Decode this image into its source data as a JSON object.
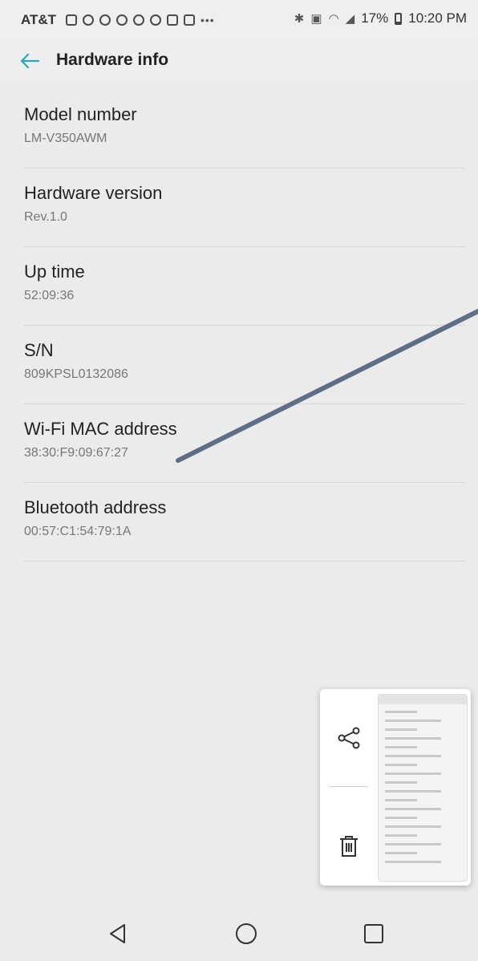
{
  "status_bar": {
    "carrier": "AT&T",
    "battery": "17%",
    "time": "10:20 PM",
    "icons": [
      "message-icon",
      "whatsapp-icon",
      "notification-icon",
      "notification-icon",
      "voicemail-icon",
      "chrome-icon",
      "gallery-icon",
      "app-icon",
      "more-icon",
      "bluetooth-icon",
      "nfc-icon",
      "wifi-icon",
      "signal-icon",
      "battery-icon"
    ]
  },
  "app_bar": {
    "title": "Hardware info"
  },
  "items": [
    {
      "label": "Model number",
      "value": "LM-V350AWM"
    },
    {
      "label": "Hardware version",
      "value": "Rev.1.0"
    },
    {
      "label": "Up time",
      "value": "52:09:36"
    },
    {
      "label": "S/N",
      "value": "809KPSL0132086"
    },
    {
      "label": "Wi-Fi MAC address",
      "value": "38:30:F9:09:67:27"
    },
    {
      "label": "Bluetooth address",
      "value": "00:57:C1:54:79:1A"
    }
  ],
  "screenshot_preview": {
    "actions": [
      "share-icon",
      "delete-icon"
    ]
  },
  "nav_bar": {
    "buttons": [
      "back-icon",
      "home-icon",
      "recents-icon"
    ]
  },
  "colors": {
    "accent": "#26a7c1",
    "annotation_arrow": "#5d6f86",
    "background": "#ecebeb"
  }
}
